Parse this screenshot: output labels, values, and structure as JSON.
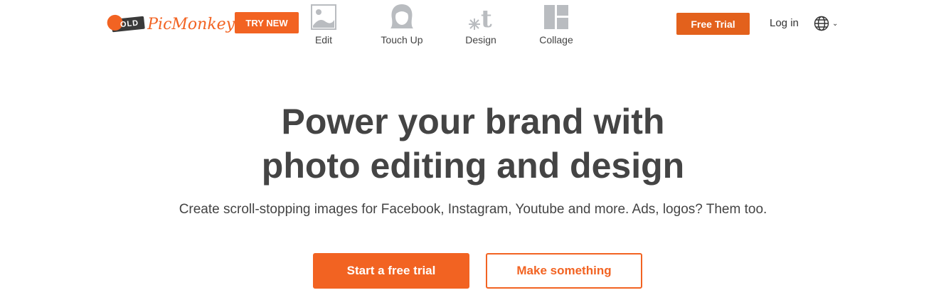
{
  "brand": {
    "logo_tag": "OLD",
    "logo_word": "PicMonkey",
    "accent": "#f26322",
    "accent_dark": "#e3611c"
  },
  "header": {
    "try_new_label": "TRY NEW",
    "nav": [
      {
        "label": "Edit",
        "icon": "image-icon"
      },
      {
        "label": "Touch Up",
        "icon": "face-icon"
      },
      {
        "label": "Design",
        "icon": "design-icon"
      },
      {
        "label": "Collage",
        "icon": "collage-icon"
      }
    ],
    "free_trial_label": "Free Trial",
    "login_label": "Log in",
    "language_icon": "globe-icon"
  },
  "hero": {
    "title_line1": "Power your brand with",
    "title_line2": "photo editing and design",
    "subtitle": "Create scroll-stopping images for Facebook, Instagram, Youtube and more. Ads, logos? Them too.",
    "primary_cta": "Start a free trial",
    "secondary_cta": "Make something"
  }
}
